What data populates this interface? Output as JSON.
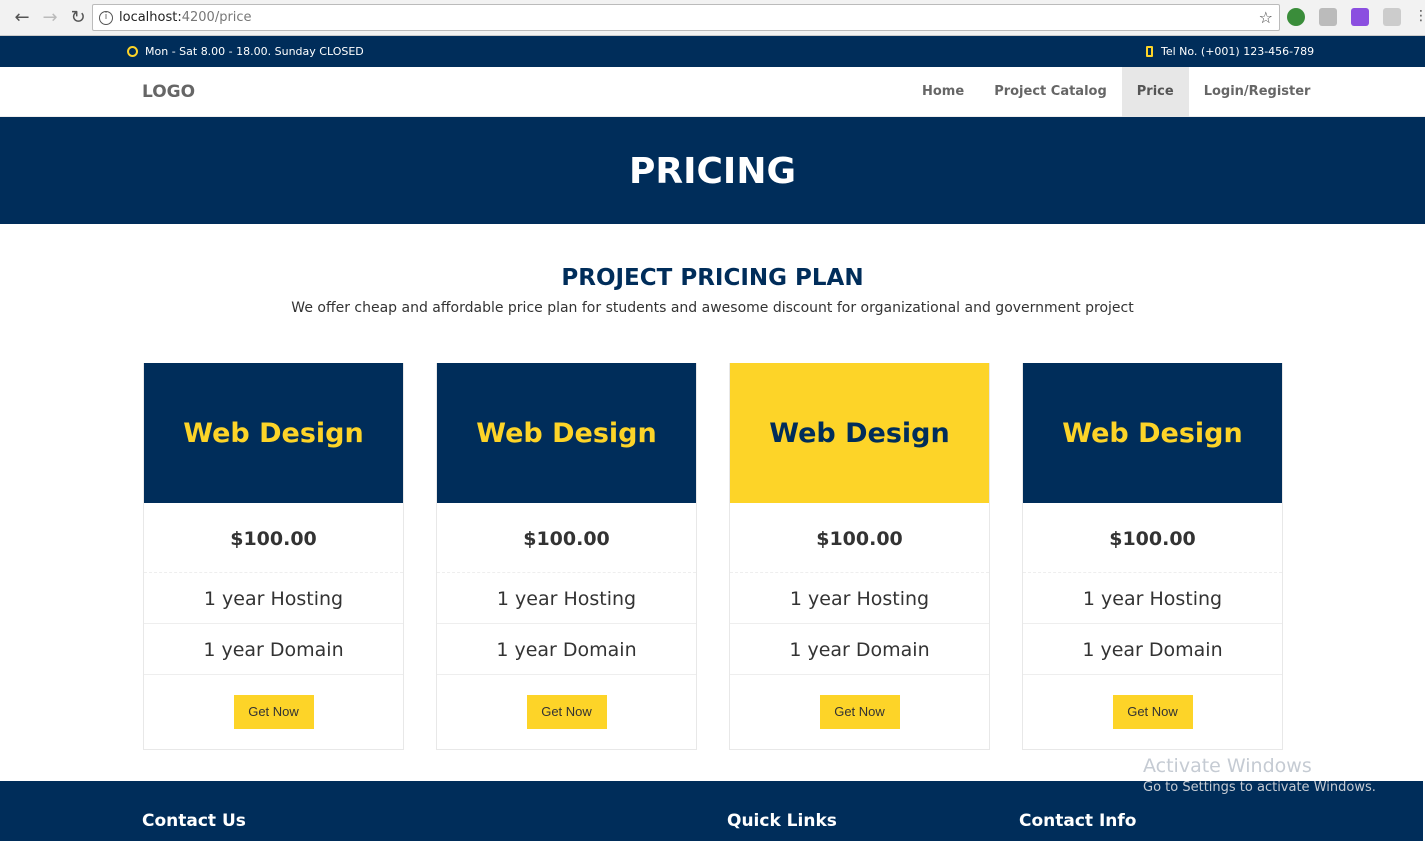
{
  "browser": {
    "url_host": "localhost:",
    "url_path": "4200/price"
  },
  "topbar": {
    "hours": "Mon - Sat 8.00 - 18.00. Sunday CLOSED",
    "phone": "Tel No. (+001) 123-456-789"
  },
  "nav": {
    "logo": "LOGO",
    "items": [
      {
        "label": "Home"
      },
      {
        "label": "Project Catalog"
      },
      {
        "label": "Price"
      },
      {
        "label": "Login/Register"
      }
    ]
  },
  "hero": {
    "title": "PRICING"
  },
  "section": {
    "title": "PROJECT PRICING PLAN",
    "subtitle": "We offer cheap and affordable price plan for students and awesome discount for organizational and government project"
  },
  "plans": [
    {
      "name": "Web Design",
      "price": "$100.00",
      "features": [
        "1 year Hosting",
        "1 year Domain"
      ],
      "button": "Get Now"
    },
    {
      "name": "Web Design",
      "price": "$100.00",
      "features": [
        "1 year Hosting",
        "1 year Domain"
      ],
      "button": "Get Now"
    },
    {
      "name": "Web Design",
      "price": "$100.00",
      "features": [
        "1 year Hosting",
        "1 year Domain"
      ],
      "button": "Get Now"
    },
    {
      "name": "Web Design",
      "price": "$100.00",
      "features": [
        "1 year Hosting",
        "1 year Domain"
      ],
      "button": "Get Now"
    }
  ],
  "footer": {
    "contact_us": "Contact Us",
    "quick_links": "Quick Links",
    "contact_info": "Contact Info"
  },
  "watermark": {
    "title": "Activate Windows",
    "subtitle": "Go to Settings to activate Windows."
  },
  "colors": {
    "navy": "#002d5a",
    "yellow": "#fdd428"
  }
}
